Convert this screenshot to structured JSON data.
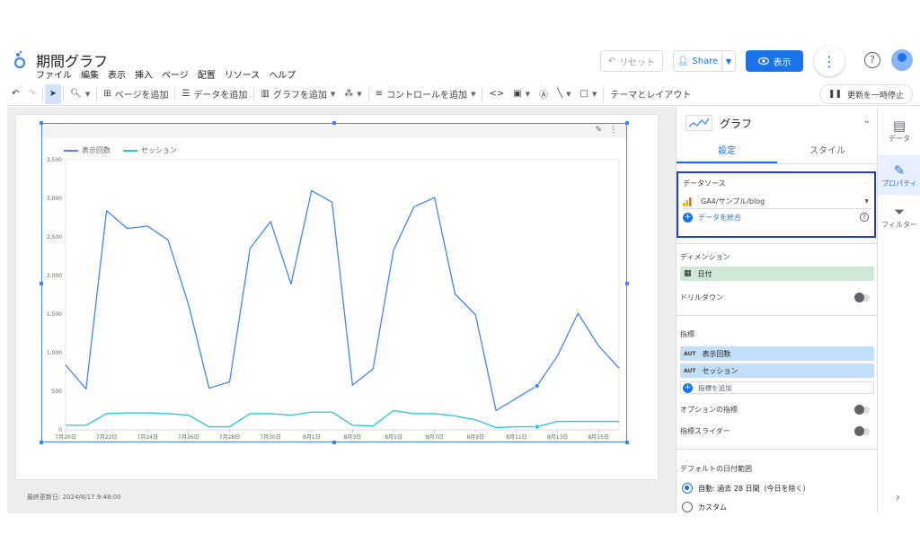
{
  "header": {
    "title": "期間グラフ",
    "menu": [
      "ファイル",
      "編集",
      "表示",
      "挿入",
      "ページ",
      "配置",
      "リソース",
      "ヘルプ"
    ],
    "reset_label": "リセット",
    "share_label": "Share",
    "view_label": "表示"
  },
  "toolbar": {
    "add_page": "ページを追加",
    "add_data": "データを追加",
    "add_chart": "グラフを追加",
    "add_control": "コントロールを追加",
    "theme_layout": "テーマとレイアウト",
    "pause_updates": "更新を一時停止"
  },
  "canvas": {
    "last_updated": "最終更新日: 2024/8/17 9:48:00"
  },
  "chart_data": {
    "type": "line",
    "categories": [
      "7月20日",
      "7月21日",
      "7月22日",
      "7月23日",
      "7月24日",
      "7月25日",
      "7月26日",
      "7月27日",
      "7月28日",
      "7月29日",
      "7月30日",
      "7月31日",
      "8月1日",
      "8月2日",
      "8月3日",
      "8月4日",
      "8月5日",
      "8月6日",
      "8月7日",
      "8月8日",
      "8月9日",
      "8月10日",
      "8月11日",
      "8月12日",
      "8月13日",
      "8月14日",
      "8月15日",
      "8月16日"
    ],
    "x_tick_labels": [
      "7月20日",
      "7月22日",
      "7月24日",
      "7月26日",
      "7月28日",
      "7月30日",
      "8月1日",
      "8月3日",
      "8月5日",
      "8月7日",
      "8月9日",
      "8月11日",
      "8月13日",
      "8月15日"
    ],
    "series": [
      {
        "name": "表示回数",
        "color": "#4285f4",
        "values": [
          840,
          530,
          2840,
          2610,
          2640,
          2460,
          1620,
          540,
          620,
          2350,
          2700,
          1890,
          3100,
          2950,
          580,
          790,
          2330,
          2890,
          3010,
          1760,
          1490,
          250,
          410,
          570,
          960,
          1510,
          1090,
          800
        ]
      },
      {
        "name": "セッション",
        "color": "#26c6da",
        "values": [
          60,
          60,
          210,
          220,
          220,
          210,
          190,
          40,
          40,
          210,
          210,
          190,
          230,
          230,
          60,
          50,
          250,
          210,
          210,
          180,
          130,
          30,
          40,
          40,
          110,
          110,
          110,
          110
        ]
      }
    ],
    "y_ticks": [
      0,
      500,
      1000,
      1500,
      2000,
      2500,
      3000,
      3500
    ],
    "y_tick_labels": [
      "0",
      "500",
      "1,000",
      "1,500",
      "2,000",
      "2,500",
      "3,000",
      "3,500"
    ],
    "ylim": [
      0,
      3500
    ],
    "legend_position": "top-left",
    "grid": false
  },
  "panel": {
    "chart_type": "グラフ",
    "tab_setup": "設定",
    "tab_style": "スタイル",
    "datasource_title": "データソース",
    "datasource_name": "GA4/サンプル/blog",
    "blend_label": "データを統合",
    "dimension_title": "ディメンション",
    "dimension_value": "日付",
    "drilldown_label": "ドリルダウン",
    "metric_title": "指標",
    "aut": "AUT",
    "metric_1": "表示回数",
    "metric_2": "セッション",
    "add_metric": "指標を追加",
    "optional_metric": "オプションの指標",
    "metric_slider": "指標スライダー",
    "date_range_title": "デフォルトの日付範囲",
    "auto_label": "自動: 過去 28 日間（今日を除く）",
    "custom_label": "カスタム"
  },
  "rail": {
    "data": "データ",
    "properties": "プロパティ",
    "filter": "フィルター"
  }
}
